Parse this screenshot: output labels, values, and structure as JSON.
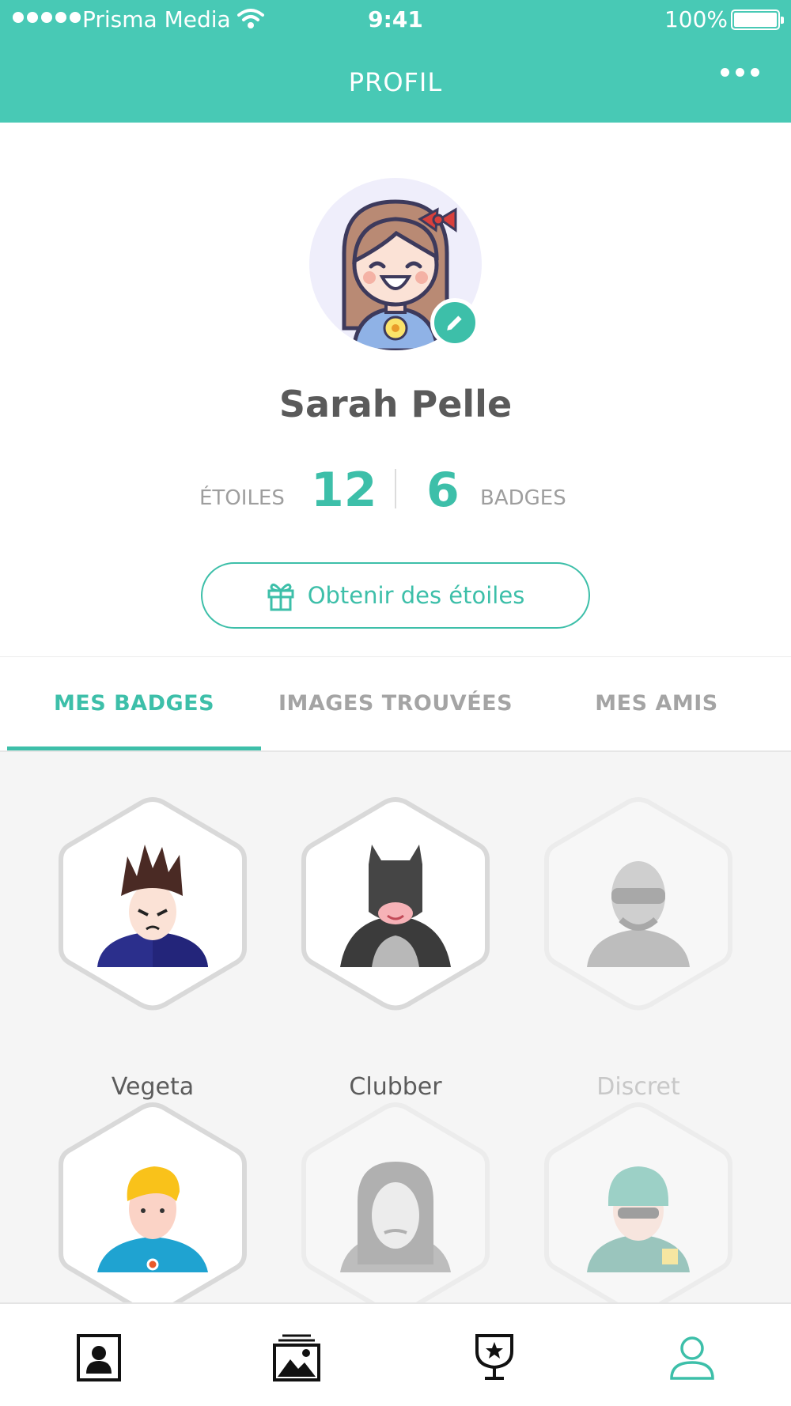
{
  "status_bar": {
    "carrier": "Prisma Media",
    "time": "9:41",
    "battery": "100%"
  },
  "nav": {
    "title": "PROFIL"
  },
  "profile": {
    "name": "Sarah Pelle",
    "stars_label": "ÉTOILES",
    "stars_count": "12",
    "badges_count": "6",
    "badges_label": "BADGES",
    "get_stars_button": "Obtenir des étoiles"
  },
  "tabs": [
    {
      "label": "MES BADGES",
      "active": true
    },
    {
      "label": "IMAGES TROUVÉES",
      "active": false
    },
    {
      "label": "MES AMIS",
      "active": false
    }
  ],
  "badges": [
    {
      "name": "Vegeta",
      "unlocked": true,
      "icon": "vegeta-icon"
    },
    {
      "name": "Clubber",
      "unlocked": true,
      "icon": "batman-icon"
    },
    {
      "name": "Discret",
      "unlocked": false,
      "icon": "masked-man-icon"
    },
    {
      "name": "",
      "unlocked": true,
      "icon": "blond-man-icon"
    },
    {
      "name": "",
      "unlocked": false,
      "icon": "anonymous-mask-icon"
    },
    {
      "name": "",
      "unlocked": false,
      "icon": "soldier-icon"
    }
  ],
  "tabbar": [
    {
      "icon": "contact-card-icon",
      "active": false
    },
    {
      "icon": "gallery-icon",
      "active": false
    },
    {
      "icon": "trophy-icon",
      "active": false
    },
    {
      "icon": "profile-icon",
      "active": true
    }
  ],
  "colors": {
    "accent": "#48c9b5",
    "text": "#5b5b5b",
    "muted": "#a4a4a4",
    "badge_background": "#f5f5f5"
  }
}
